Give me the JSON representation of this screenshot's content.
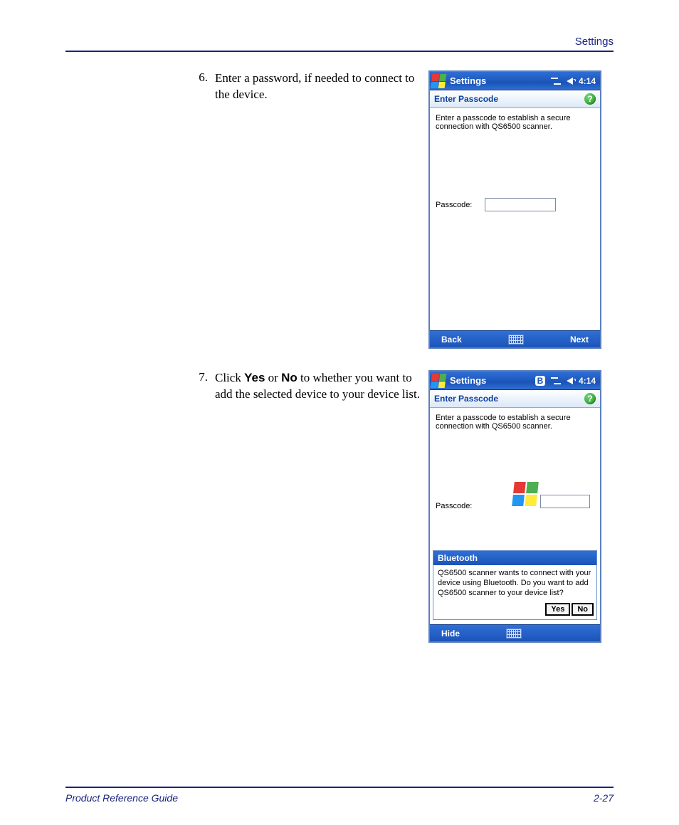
{
  "header": {
    "section": "Settings"
  },
  "steps": [
    {
      "num": "6.",
      "text": "Enter a password, if needed to connect to the device."
    },
    {
      "num": "7.",
      "pre": "Click ",
      "b1": "Yes",
      "mid": " or ",
      "b2": "No",
      "post": " to whether you want to add the selected device to your device list."
    }
  ],
  "screen1": {
    "titlebar": "Settings",
    "time": "4:14",
    "subhead": "Enter Passcode",
    "instruction": "Enter a passcode to establish a secure connection with QS6500 scanner.",
    "passcode_label": "Passcode:",
    "back": "Back",
    "next": "Next"
  },
  "screen2": {
    "titlebar": "Settings",
    "time": "4:14",
    "subhead": "Enter Passcode",
    "instruction": "Enter a passcode to establish a secure connection with QS6500 scanner.",
    "passcode_label": "Passcode:",
    "popup_title": "Bluetooth",
    "popup_body": "QS6500 scanner wants to connect with your device using Bluetooth. Do you want to add QS6500 scanner to your device list?",
    "yes": "Yes",
    "no": "No",
    "hide": "Hide"
  },
  "footer": {
    "left": "Product Reference Guide",
    "right": "2-27"
  }
}
